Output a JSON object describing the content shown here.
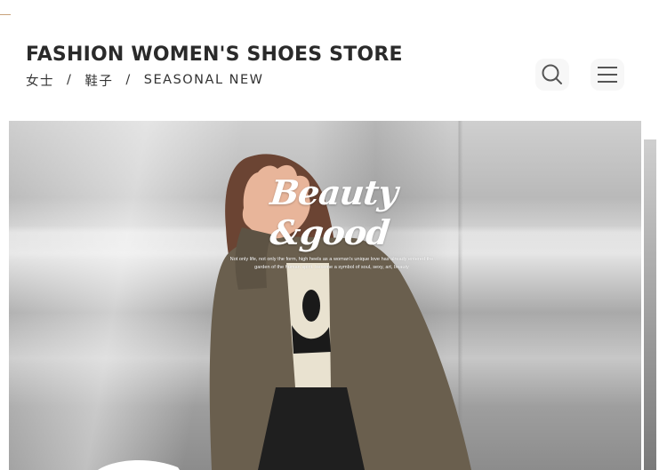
{
  "header": {
    "title": "FASHION WOMEN'S SHOES STORE",
    "subtitle": {
      "part1": "女士",
      "separator": "/",
      "part2": "鞋子",
      "part3": "SEASONAL NEW"
    },
    "icons": {
      "search": "search-icon",
      "menu": "menu-icon"
    }
  },
  "banner": {
    "title": "Beauty &good",
    "desc_line1": "Not only life, not only the form, high heels as a woman's unique love has already entered the",
    "desc_line2": "garden of the human spirit, become a symbol of soul, sexy, art, beauty"
  },
  "colors": {
    "accent_line": "#c8a27a",
    "text_dark": "#2a2a2a"
  }
}
